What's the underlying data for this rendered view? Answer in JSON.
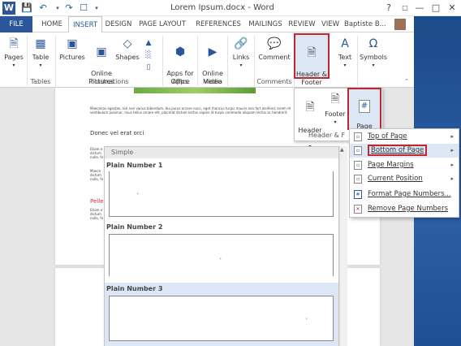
{
  "window": {
    "title": "Lorem Ipsum.docx - Word",
    "help": "?",
    "minimize": "—",
    "restore": "□",
    "close": "✕"
  },
  "tabs": [
    "FILE",
    "HOME",
    "INSERT",
    "DESIGN",
    "PAGE LAYOUT",
    "REFERENCES",
    "MAILINGS",
    "REVIEW",
    "VIEW"
  ],
  "user": "Baptiste B...",
  "ribbon": {
    "pages": "Pages",
    "table": "Table",
    "pictures": "Pictures",
    "online_pictures": "Online\nPictures",
    "shapes": "Shapes",
    "apps_for_office": "Apps for\nOffice",
    "online_video": "Online\nVideo",
    "links": "Links",
    "comment": "Comment",
    "header_footer": "Header &\nFooter",
    "text": "Text",
    "symbols": "Symbols",
    "groups": {
      "tables": "Tables",
      "illustrations": "Illustrations",
      "apps": "Apps",
      "media": "Media",
      "comments": "Comments",
      "header_footer": "Header & F"
    }
  },
  "hf_panel": {
    "header": "Header",
    "footer": "Footer",
    "page_number": "Page\nNumber"
  },
  "document": {
    "para1": "Maecenas egestas, nisl non varius bibendum, dui purus ornare nunc, eget rhoncus turpis mauris non fort eleifend, lorem et vestibulum pulvinar, risus tellus ornare elit, placerat dictum lectus sapien id turpis commodo aliquam lectus ac hendrerit.",
    "heading1": "Donec vel erat orci",
    "para2a": "Etiam e dictum nulla, fe",
    "para2b": "Maece dictum nulla, fe",
    "heading2": "Pelle",
    "para3": "Etiam e dictum nulla, fe"
  },
  "gallery": {
    "section": "Simple",
    "items": [
      {
        "title": "Plain Number 1"
      },
      {
        "title": "Plain Number 2"
      },
      {
        "title": "Plain Number 3"
      }
    ]
  },
  "page_number_menu": {
    "items": [
      {
        "label": "Top of Page",
        "submenu": true
      },
      {
        "label": "Bottom of Page",
        "submenu": true
      },
      {
        "label": "Page Margins",
        "submenu": true
      },
      {
        "label": "Current Position",
        "submenu": true
      },
      {
        "label": "Format Page Numbers...",
        "submenu": false
      },
      {
        "label": "Remove Page Numbers",
        "submenu": false
      }
    ]
  },
  "colors": {
    "accent": "#2b579a",
    "highlight_red": "#c0272d",
    "selection": "#dce6f4"
  }
}
